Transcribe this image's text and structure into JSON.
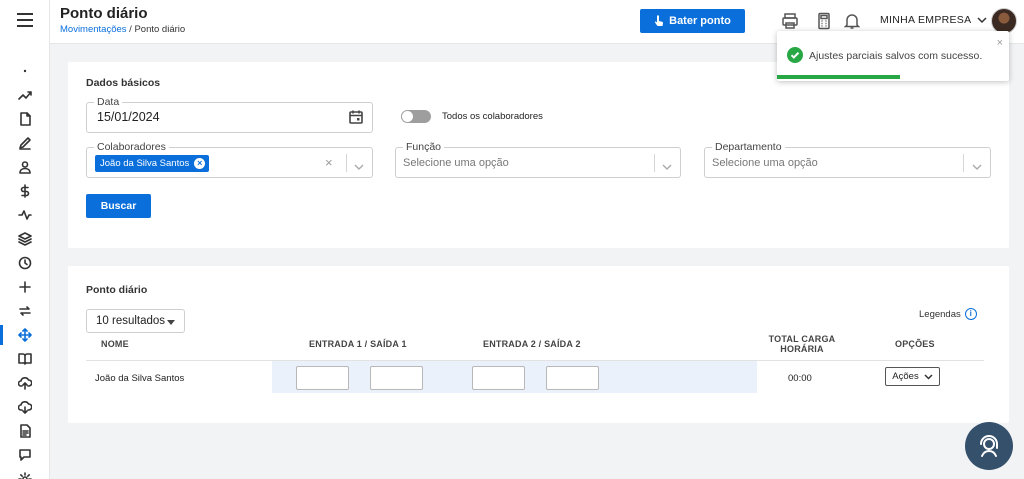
{
  "header": {
    "title": "Ponto diário",
    "breadcrumb": {
      "parent": "Movimentações",
      "separator": "/",
      "current": "Ponto diário"
    },
    "bater_ponto_label": "Bater ponto",
    "company": "MINHA EMPRESA"
  },
  "sidebar": {
    "items": [
      {
        "icon": "dot-icon"
      },
      {
        "icon": "trend-icon"
      },
      {
        "icon": "document-icon"
      },
      {
        "icon": "pen-icon"
      },
      {
        "icon": "user-icon"
      },
      {
        "icon": "dollar-icon"
      },
      {
        "icon": "pulse-icon"
      },
      {
        "icon": "layers-icon"
      },
      {
        "icon": "clock-icon"
      },
      {
        "icon": "plus-icon"
      },
      {
        "icon": "exchange-icon"
      },
      {
        "icon": "move-icon",
        "active": true
      },
      {
        "icon": "book-icon"
      },
      {
        "icon": "cloud-upload-icon"
      },
      {
        "icon": "cloud-download-icon"
      },
      {
        "icon": "file-text-icon"
      },
      {
        "icon": "chat-icon"
      },
      {
        "icon": "gear-icon"
      }
    ]
  },
  "filters": {
    "section_title": "Dados básicos",
    "data": {
      "label": "Data",
      "value": "15/01/2024"
    },
    "toggle_label": "Todos os colaboradores",
    "toggle_on": false,
    "colaboradores": {
      "label": "Colaboradores",
      "selected": [
        "João da Silva Santos"
      ],
      "clear": "×"
    },
    "funcao": {
      "label": "Função",
      "placeholder": "Selecione uma opção"
    },
    "departamento": {
      "label": "Departamento",
      "placeholder": "Selecione uma opção"
    },
    "buscar_label": "Buscar"
  },
  "table": {
    "section_title": "Ponto diário",
    "page_size": "10 resultados",
    "legendas_label": "Legendas",
    "info_glyph": "i",
    "columns": {
      "nome": "NOME",
      "entrada1": "ENTRADA 1 / SAÍDA 1",
      "entrada2": "ENTRADA 2 / SAÍDA 2",
      "total_line1": "TOTAL CARGA",
      "total_line2": "HORÁRIA",
      "opcoes": "OPÇÕES"
    },
    "rows": [
      {
        "nome": "João da Silva Santos",
        "entrada1": "",
        "saida1": "",
        "entrada2": "",
        "saida2": "",
        "total": "00:00",
        "acoes": "Ações"
      }
    ]
  },
  "toast": {
    "message": "Ajustes parciais salvos com sucesso.",
    "close": "×",
    "progress": 0.53,
    "color": "#28a745"
  },
  "colors": {
    "accent": "#0a6fdb",
    "success": "#28a745",
    "support": "#35506b"
  }
}
